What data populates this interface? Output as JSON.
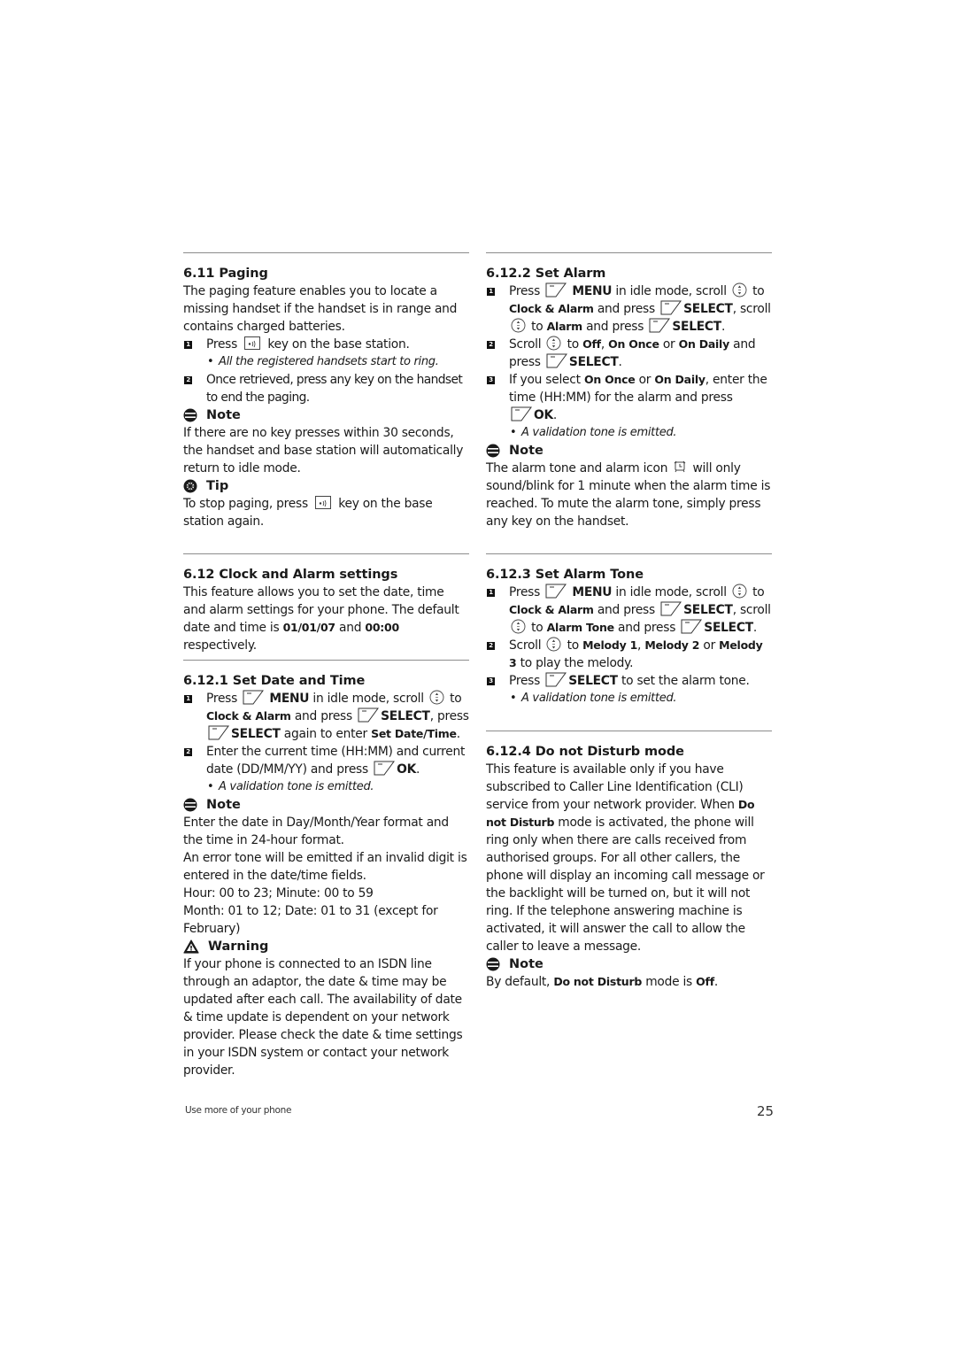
{
  "left": {
    "paging": {
      "heading": "6.11  Paging",
      "intro": "The paging feature enables you to locate a missing handset if the handset is in range and contains charged batteries.",
      "steps": [
        {
          "num": "1",
          "pre": "Press",
          "post": "key on the base station."
        },
        {
          "num": "2",
          "text": "Once retrieved, press any key on the handset to end the paging."
        }
      ],
      "bullet": "All the registered handsets start to ring.",
      "note_label": "Note",
      "note_text": "If there are no key presses within 30 seconds, the handset and base station will automatically return to idle mode.",
      "tip_label": "Tip",
      "tip_pre": "To stop paging, press",
      "tip_post": "key on the base station again."
    },
    "clock": {
      "heading": "6.12  Clock and Alarm settings",
      "intro_pre": "This feature allows you to set the date, time and alarm settings for your phone. The default date and time is ",
      "default_date": "01/01/07",
      "and": " and ",
      "default_time": "00:00",
      "intro_post": " respectively."
    },
    "date_time": {
      "heading": "6.12.1 Set Date and Time",
      "step1": {
        "num": "1",
        "press": "Press",
        "menu": "MENU",
        "t1": " in idle mode, scroll",
        "to": "to",
        "clock": "Clock & Alarm",
        "and_press": " and press",
        "select": "SELECT",
        "comma_press": ", press",
        "select2": "SELECT",
        "again": " again to enter ",
        "set_dt": "Set Date/Time",
        "dot": "."
      },
      "step2": {
        "num": "2",
        "text": "Enter the current time (HH:MM) and current date (DD/MM/YY) and press",
        "ok": "OK",
        "dot": "."
      },
      "bullet": "A validation tone is emitted.",
      "note_label": "Note",
      "note_lines": [
        "Enter the date in Day/Month/Year format and the time in 24-hour format.",
        "An error tone will be emitted if an invalid digit is entered in the date/time fields.",
        "Hour: 00 to 23; Minute: 00 to 59",
        "Month: 01 to 12; Date: 01 to 31 (except for February)"
      ],
      "warning_label": "Warning",
      "warning_text": "If your phone is connected to an ISDN line through an adaptor, the date & time may be updated after each call. The availability of date & time update is dependent on your network provider. Please check the date & time settings in your ISDN system or contact your network provider."
    }
  },
  "right": {
    "set_alarm": {
      "heading": "6.12.2 Set Alarm",
      "step1": {
        "num": "1",
        "press": "Press",
        "menu": "MENU",
        "t1": " in idle mode, scroll",
        "to": "to",
        "clock": "Clock & Alarm",
        "and_press": " and press",
        "select": "SELECT",
        "scroll": ", scroll",
        "to2": " to ",
        "item": "Alarm",
        "and_press2": " and press",
        "select2": "SELECT",
        "dot": "."
      },
      "step2": {
        "num": "2",
        "scroll": "Scroll",
        "to": " to ",
        "off": "Off",
        "comma": ", ",
        "once": "On Once",
        "or": " or ",
        "daily": "On Daily",
        "and": " and press",
        "select": "SELECT",
        "dot": "."
      },
      "step3": {
        "num": "3",
        "t1": "If you select ",
        "once": "On Once",
        "or": " or ",
        "daily": "On Daily",
        "t2": ", enter the time (HH:MM) for the alarm and press",
        "ok": "OK",
        "dot": "."
      },
      "bullet": "A validation tone is emitted.",
      "note_label": "Note",
      "note_pre": "The alarm tone and alarm icon",
      "note_post": "will only sound/blink for 1 minute when the alarm time is reached. To mute the alarm tone, simply press any key on the handset."
    },
    "alarm_tone": {
      "heading": "6.12.3 Set Alarm Tone",
      "step1": {
        "num": "1",
        "press": "Press",
        "menu": "MENU",
        "t1": " in idle mode, scroll",
        "to": "to",
        "clock": "Clock & Alarm",
        "and_press": " and press",
        "select": "SELECT",
        "scroll": ", scroll",
        "to2": " to ",
        "item": "Alarm Tone",
        "and_press2": " and press",
        "select2": "SELECT",
        "dot": "."
      },
      "step2": {
        "num": "2",
        "scroll": "Scroll",
        "to": " to ",
        "m1": "Melody 1",
        "comma": ", ",
        "m2": "Melody 2",
        "or": " or ",
        "m3": "Melody 3",
        "t2": " to play the melody."
      },
      "step3": {
        "num": "3",
        "press": "Press",
        "select": "SELECT",
        "t2": " to set the alarm tone."
      },
      "bullet": "A validation tone is emitted."
    },
    "dnd": {
      "heading": "6.12.4 Do not Disturb mode",
      "text_pre": "This feature is available only if you have subscribed to Caller Line Identification (CLI) service from your network provider. When ",
      "dnd_bold": "Do not Disturb",
      "text_post": " mode is activated, the phone will ring only when there are calls received from authorised groups. For all other callers, the phone will display an incoming call message or the backlight will be turned on, but it will not ring. If the telephone answering machine is activated, it will answer the call to allow the caller to leave a message.",
      "note_label": "Note",
      "note_pre": "By default, ",
      "note_bold": "Do not Disturb",
      "note_mid": " mode is ",
      "note_off": "Off",
      "note_dot": "."
    }
  },
  "footer": {
    "section": "Use more of your phone",
    "page": "25"
  }
}
